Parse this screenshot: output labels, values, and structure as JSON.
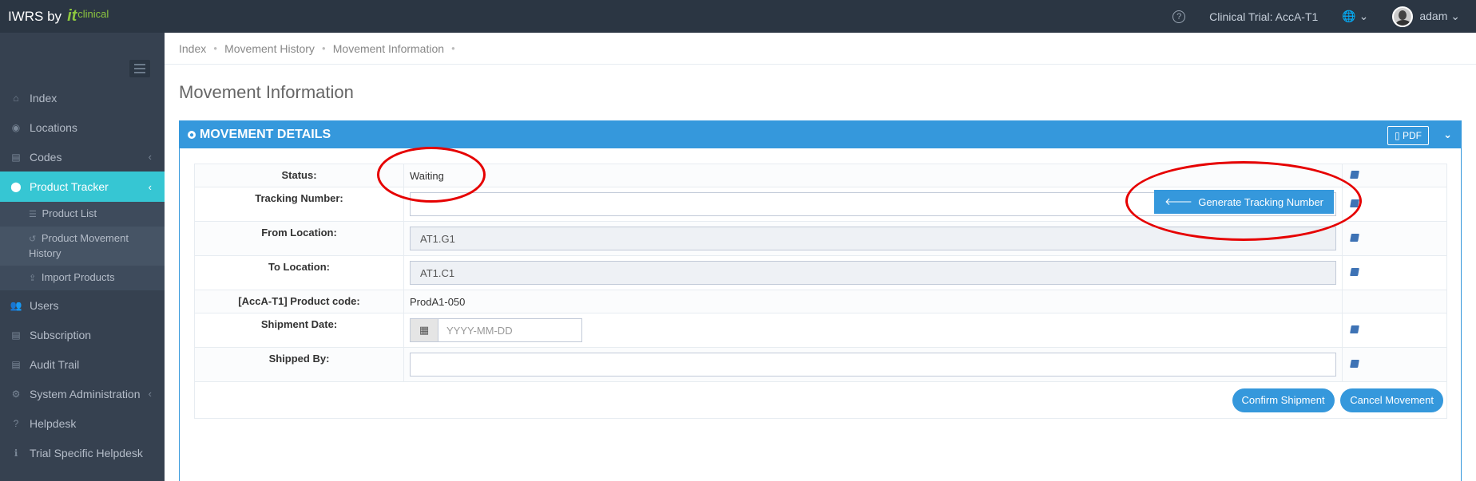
{
  "brand": {
    "name": "IWRS by",
    "logo_it": "it",
    "logo_clinical": "clinical"
  },
  "topbar": {
    "help_icon": "?",
    "trial": "Clinical Trial: AccA-T1",
    "globe_icon": "🌐 ⌄",
    "user": "adam ⌄"
  },
  "sidebar": {
    "items": [
      {
        "icon": "⌂",
        "label": "Index"
      },
      {
        "icon": "◉",
        "label": "Locations"
      },
      {
        "icon": "▤",
        "label": "Codes",
        "arrow": "‹"
      },
      {
        "icon": "⬤",
        "label": "Product Tracker",
        "arrow": "‹"
      },
      {
        "icon": "👥",
        "label": "Users"
      },
      {
        "icon": "▤",
        "label": "Subscription"
      },
      {
        "icon": "▤",
        "label": "Audit Trail"
      },
      {
        "icon": "⚙",
        "label": "System Administration",
        "arrow": "‹"
      },
      {
        "icon": "?",
        "label": "Helpdesk"
      },
      {
        "icon": "ℹ",
        "label": "Trial Specific Helpdesk"
      }
    ],
    "sub_items": [
      {
        "icon": "☰",
        "label": "Product List"
      },
      {
        "icon": "↺",
        "label": "Product Movement History"
      },
      {
        "icon": "⇪",
        "label": "Import Products"
      }
    ]
  },
  "breadcrumb": [
    "Index",
    "Movement History",
    "Movement Information"
  ],
  "page_title": "Movement Information",
  "panel": {
    "title": "MOVEMENT DETAILS",
    "pdf_label": "PDF",
    "collapse_icon": "⌄"
  },
  "form": {
    "status_label": "Status:",
    "status_value": "Waiting",
    "tracking_label": "Tracking Number:",
    "tracking_value": "",
    "generate_label": "Generate Tracking Number",
    "from_label": "From Location:",
    "from_value": "AT1.G1",
    "to_label": "To Location:",
    "to_value": "AT1.C1",
    "product_code_label": "[AccA-T1] Product code:",
    "product_code_value": "ProdA1-050",
    "shipment_date_label": "Shipment Date:",
    "shipment_date_placeholder": "YYYY-MM-DD",
    "shipped_by_label": "Shipped By:",
    "shipped_by_value": ""
  },
  "actions": {
    "confirm": "Confirm Shipment",
    "cancel": "Cancel Movement"
  }
}
